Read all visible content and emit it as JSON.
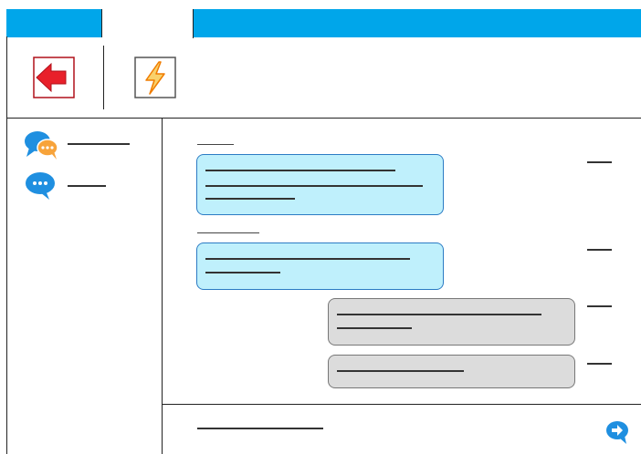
{
  "tabs": [
    {
      "label": ""
    },
    {
      "label": "",
      "active": true
    },
    {
      "label": ""
    }
  ],
  "toolbar": {
    "back_icon": "arrow-left-icon",
    "quick_icon": "lightning-icon"
  },
  "sidebar": {
    "items": [
      {
        "icon": "group-chat-icon",
        "label": ""
      },
      {
        "icon": "chat-icon",
        "label": ""
      }
    ]
  },
  "messages": [
    {
      "sender": "",
      "text": "",
      "time": "",
      "side": "left"
    },
    {
      "sender": "",
      "text": "",
      "time": "",
      "side": "left"
    },
    {
      "text": "",
      "time": "",
      "side": "right"
    },
    {
      "text": "",
      "time": "",
      "side": "right"
    }
  ],
  "composer": {
    "placeholder": "",
    "send_icon": "send-icon"
  },
  "colors": {
    "tab_bar": "#00a6ea",
    "incoming_bubble": "#bff0fc",
    "incoming_border": "#2b7bc4",
    "outgoing_bubble": "#dcdcdc",
    "outgoing_border": "#777777",
    "back_arrow": "#e8202a",
    "lightning": "#f79a1f",
    "chat_icon": "#1f8fe0"
  }
}
